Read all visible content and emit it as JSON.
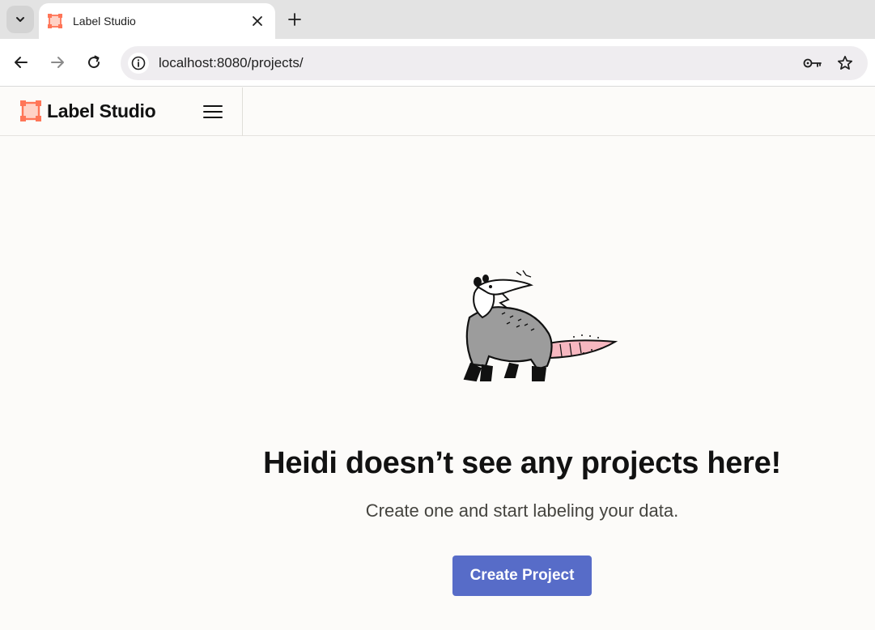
{
  "browser": {
    "tab_title": "Label Studio",
    "url": "localhost:8080/projects/"
  },
  "app": {
    "brand_name": "Label Studio",
    "accent_color": "#ff7557",
    "primary_color": "#576cc8"
  },
  "empty_state": {
    "title": "Heidi doesn’t see any projects here!",
    "subtitle": "Create one and start labeling your data.",
    "button_label": "Create Project"
  },
  "icons": {
    "tab_search": "chevron-down-icon",
    "tab_close": "close-icon",
    "new_tab": "plus-icon",
    "back": "arrow-left-icon",
    "forward": "arrow-right-icon",
    "reload": "reload-icon",
    "site_info": "info-icon",
    "password": "key-icon",
    "bookmark": "star-icon",
    "menu": "hamburger-menu-icon",
    "mascot": "opossum-illustration"
  }
}
